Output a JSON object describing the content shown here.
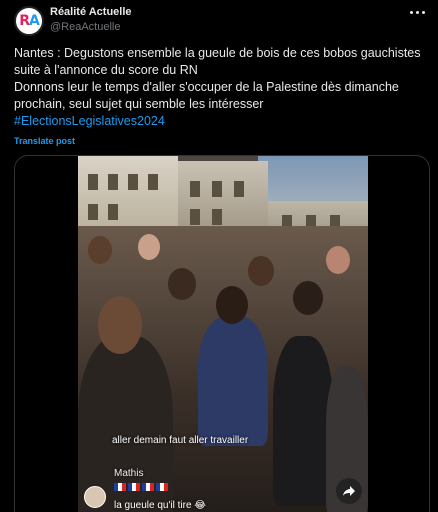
{
  "author": {
    "display_name": "Réalité Actuelle",
    "handle": "@ReaActuelle",
    "avatar_initials_r": "R",
    "avatar_initials_a": "A"
  },
  "post": {
    "lines": [
      "Nantes : Degustons ensemble la gueule de bois de ces bobos gauchistes",
      "suite à l'annonce du score du RN",
      "Donnons leur le temps d'aller s'occuper de la Palestine dès dimanche",
      "prochain, seul sujet qui semble les intéresser"
    ],
    "hashtag": "#ElectionsLegislatives2024",
    "translate_label": "Translate post"
  },
  "video": {
    "caption": "aller demain faut aller travailler",
    "comment_user": "Mathis",
    "comment_text": "la gueule qu'il tire 😂"
  },
  "colors": {
    "background": "#000000",
    "text": "#e7e9ea",
    "muted": "#71767b",
    "link": "#1d9bf0"
  },
  "icons": [
    "more-icon",
    "share-icon"
  ]
}
